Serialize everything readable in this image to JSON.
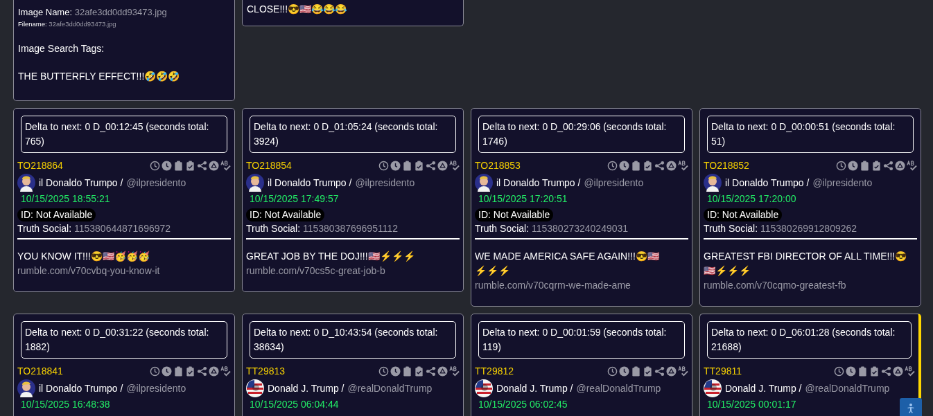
{
  "top_cards": [
    {
      "kind": "image",
      "image_name_label": "Image Name:",
      "image_name": "32afe3dd0dd93473.jpg",
      "filename_label": "Filename:",
      "filename": "32afe3dd0dd93473.jpg",
      "tags_label": "Image Search Tags:",
      "text": "THE BUTTERFLY EFFECT!!!🤣🤣🤣"
    },
    {
      "kind": "text",
      "text": "CLOSE!!!😎🇺🇸😂😂😂"
    }
  ],
  "posts": [
    {
      "delta": "Delta to next: 0 D_00:12:45 (seconds total: 765)",
      "post_id": "TO218864",
      "author": "il Donaldo Trumpo /",
      "handle": "@ilpresidento",
      "avatar": {
        "kind": "portrait"
      },
      "date": "10/15/2025 18:55:21",
      "id_label": "ID: Not Available",
      "source_label": "Truth Social:",
      "source_id": "115380644871696972",
      "text": "YOU KNOW IT!!!😎🇺🇸🥳🥳🥳",
      "link": "rumble.com/v70cvbq-you-know-it",
      "highlighted": false
    },
    {
      "delta": "Delta to next: 0 D_01:05:24 (seconds total: 3924)",
      "post_id": "TO218854",
      "author": "il Donaldo Trumpo /",
      "handle": "@ilpresidento",
      "avatar": {
        "kind": "portrait"
      },
      "date": "10/15/2025 17:49:57",
      "id_label": "ID: Not Available",
      "source_label": "Truth Social:",
      "source_id": "115380387696951112",
      "text": "GREAT JOB BY THE DOJ!!!🇺🇸⚡⚡⚡",
      "link": "rumble.com/v70cs5c-great-job-b",
      "highlighted": false
    },
    {
      "delta": "Delta to next: 0 D_00:29:06 (seconds total: 1746)",
      "post_id": "TO218853",
      "author": "il Donaldo Trumpo /",
      "handle": "@ilpresidento",
      "avatar": {
        "kind": "portrait"
      },
      "date": "10/15/2025 17:20:51",
      "id_label": "ID: Not Available",
      "source_label": "Truth Social:",
      "source_id": "115380273240249031",
      "text": "WE MADE AMERICA SAFE AGAIN!!!😎🇺🇸⚡⚡⚡",
      "link": "rumble.com/v70cqrm-we-made-ame",
      "highlighted": false
    },
    {
      "delta": "Delta to next: 0 D_00:00:51 (seconds total: 51)",
      "post_id": "TO218852",
      "author": "il Donaldo Trumpo /",
      "handle": "@ilpresidento",
      "avatar": {
        "kind": "portrait"
      },
      "date": "10/15/2025 17:20:00",
      "id_label": "ID: Not Available",
      "source_label": "Truth Social:",
      "source_id": "115380269912809262",
      "text": "GREATEST FBI DIRECTOR OF ALL TIME!!!😎🇺🇸⚡⚡⚡",
      "link": "rumble.com/v70cqmo-greatest-fb",
      "highlighted": false
    },
    {
      "delta": "Delta to next: 0 D_00:31:22 (seconds total: 1882)",
      "post_id": "TO218841",
      "author": "il Donaldo Trumpo /",
      "handle": "@ilpresidento",
      "avatar": {
        "kind": "portrait"
      },
      "date": "10/15/2025 16:48:38",
      "highlighted": false
    },
    {
      "delta": "Delta to next: 0 D_10:43:54 (seconds total: 38634)",
      "post_id": "TT29813",
      "author": "Donald J. Trump /",
      "handle": "@realDonaldTrump",
      "avatar": {
        "kind": "flag"
      },
      "date": "10/15/2025 06:04:44",
      "highlighted": false
    },
    {
      "delta": "Delta to next: 0 D_00:01:59 (seconds total: 119)",
      "post_id": "TT29812",
      "author": "Donald J. Trump /",
      "handle": "@realDonaldTrump",
      "avatar": {
        "kind": "flag"
      },
      "date": "10/15/2025 06:02:45",
      "highlighted": false
    },
    {
      "delta": "Delta to next: 0 D_06:01:28 (seconds total: 21688)",
      "post_id": "TT29811",
      "author": "Donald J. Trump /",
      "handle": "@realDonaldTrump",
      "avatar": {
        "kind": "flag"
      },
      "date": "10/15/2025 00:01:17",
      "highlighted": true
    }
  ]
}
